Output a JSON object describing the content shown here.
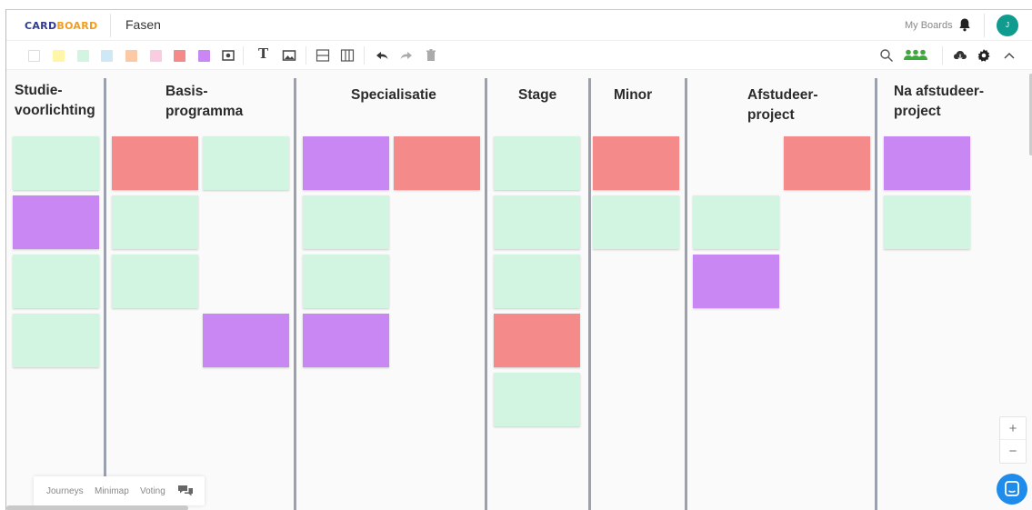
{
  "header": {
    "logo_part1": "CARD",
    "logo_part2": "BOARD",
    "board_title": "Fasen",
    "my_boards": "My Boards",
    "avatar_initial": "J"
  },
  "toolbar": {
    "swatches": [
      "#ffffff",
      "#fff6a8",
      "#d1f5e1",
      "#cfe8f5",
      "#fcc9a7",
      "#fbcce1",
      "#f48a8a",
      "#c987f4"
    ],
    "text_tool": "T",
    "icons": [
      "camera-icon",
      "text-icon",
      "image-icon",
      "split-horizontal-icon",
      "split-vertical-icon",
      "undo-icon",
      "redo-icon",
      "trash-icon",
      "search-icon",
      "users-icon",
      "cloud-icon",
      "gear-icon",
      "chevron-up-icon"
    ]
  },
  "colors": {
    "green": "#d1f5e1",
    "purple": "#c987f4",
    "red": "#f48a8a",
    "accent_green": "#3ba93b",
    "divider": "#9ba0ad"
  },
  "columns": [
    {
      "line1": "Studie-",
      "line2": "voorlichting"
    },
    {
      "line1": "Basis-",
      "line2": "programma"
    },
    {
      "line1": "Specialisatie",
      "line2": ""
    },
    {
      "line1": "Stage",
      "line2": ""
    },
    {
      "line1": "Minor",
      "line2": ""
    },
    {
      "line1": "Afstudeer-",
      "line2": "project"
    },
    {
      "line1": "Na afstudeer-",
      "line2": "project"
    }
  ],
  "bottom_panel": {
    "journeys": "Journeys",
    "minimap": "Minimap",
    "voting": "Voting"
  },
  "zoom": {
    "plus": "+",
    "minus": "−"
  }
}
